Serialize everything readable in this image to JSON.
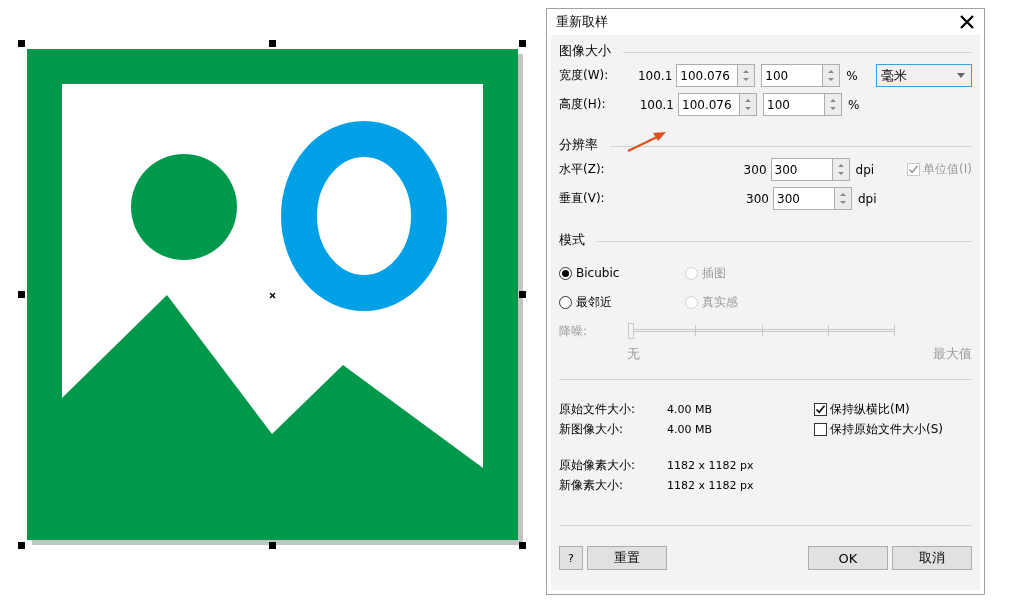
{
  "canvas": {
    "selected": true
  },
  "dialog": {
    "title": "重新取样",
    "image_size": {
      "heading": "图像大小",
      "unit_dropdown": {
        "value": "毫米"
      },
      "rows": [
        {
          "label": "宽度(W):",
          "original": "100.1",
          "value": "100.076",
          "percent": "100",
          "percent_sign": "%"
        },
        {
          "label": "高度(H):",
          "original": "100.1",
          "value": "100.076",
          "percent": "100",
          "percent_sign": "%"
        }
      ]
    },
    "resolution": {
      "heading": "分辨率",
      "identical_values": {
        "label": "单位值(I)",
        "checked": true,
        "disabled": true
      },
      "rows": [
        {
          "label": "水平(Z):",
          "original": "300",
          "value": "300",
          "unit": "dpi"
        },
        {
          "label": "垂直(V):",
          "original": "300",
          "value": "300",
          "unit": "dpi"
        }
      ]
    },
    "mode": {
      "heading": "模式",
      "options": [
        {
          "label": "Bicubic",
          "selected": true,
          "disabled": false
        },
        {
          "label": "插图",
          "selected": false,
          "disabled": true
        },
        {
          "label": "最邻近",
          "selected": false,
          "disabled": false
        },
        {
          "label": "真实感",
          "selected": false,
          "disabled": true
        }
      ],
      "noise": {
        "label": "降噪:",
        "level": 0,
        "disabled": true,
        "min_label": "无",
        "max_label": "最大值"
      }
    },
    "info": [
      {
        "label": "原始文件大小:",
        "value": "4.00 MB"
      },
      {
        "label": "新图像大小:",
        "value": "4.00 MB"
      },
      {
        "label": "原始像素大小:",
        "value": "1182 x 1182 px"
      },
      {
        "label": "新像素大小:",
        "value": "1182 x 1182 px"
      }
    ],
    "options": [
      {
        "label": "保持纵横比(M)",
        "checked": true
      },
      {
        "label": "保持原始文件大小(S)",
        "checked": false
      }
    ],
    "buttons": [
      {
        "label": "?",
        "kind": "help"
      },
      {
        "label": "重置",
        "kind": "reset"
      },
      {
        "label": "OK",
        "kind": "ok"
      },
      {
        "label": "取消",
        "kind": "cancel"
      }
    ]
  }
}
